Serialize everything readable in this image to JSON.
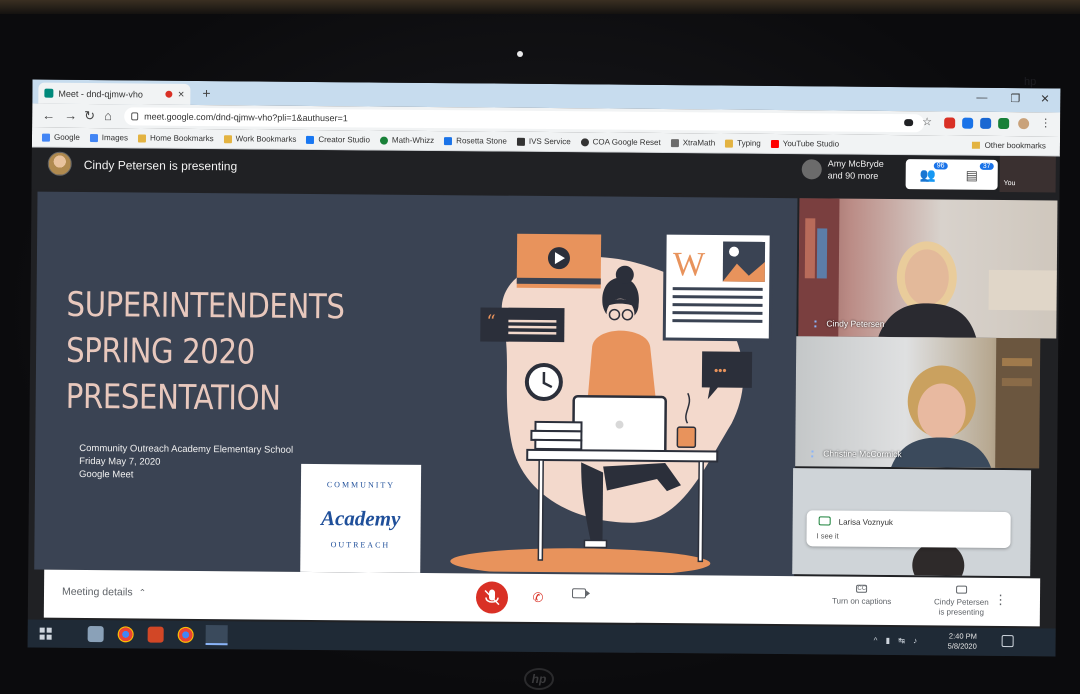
{
  "browser": {
    "tab_title": "Meet - dnd-qjmw-vho",
    "tab_close": "×",
    "new_tab": "+",
    "url": "meet.google.com/dnd-qjmw-vho?pli=1&authuser=1",
    "bookmarks": [
      {
        "label": "Google",
        "color": "#4285f4"
      },
      {
        "label": "Images",
        "color": "#4285f4"
      },
      {
        "label": "Home Bookmarks",
        "color": "#e3b341"
      },
      {
        "label": "Work Bookmarks",
        "color": "#e3b341"
      },
      {
        "label": "Creator Studio",
        "color": "#1877f2"
      },
      {
        "label": "Math-Whizz",
        "color": "#188038"
      },
      {
        "label": "Rosetta Stone",
        "color": "#1a73e8"
      },
      {
        "label": "IVS Service",
        "color": "#333333"
      },
      {
        "label": "COA Google Reset",
        "color": "#333333"
      },
      {
        "label": "XtraMath",
        "color": "#6b6b6b"
      },
      {
        "label": "Typing",
        "color": "#e3b341"
      },
      {
        "label": "YouTube Studio",
        "color": "#ff0000"
      }
    ],
    "other_bookmarks": "Other bookmarks"
  },
  "meet": {
    "presenting_label": "Cindy Petersen is presenting",
    "others_line1": "Amy McBryde",
    "others_line2": "and 90 more",
    "people_count": "96",
    "chat_count": "37",
    "you_label": "You",
    "participants": [
      {
        "name": "Cindy Petersen"
      },
      {
        "name": "Christine McCormick"
      }
    ],
    "chat": {
      "sender": "Larisa Voznyuk",
      "message": "I see it"
    },
    "meeting_details": "Meeting details",
    "captions_icon": "CC",
    "captions_label": "Turn on captions",
    "present_line1": "Cindy Petersen",
    "present_line2": "is presenting",
    "more_glyph": "⋮"
  },
  "slide": {
    "title_line1": "SUPERINTENDENTS",
    "title_line2": "SPRING 2020",
    "title_line3": "PRESENTATION",
    "sub_line1": "Community Outreach Academy Elementary School",
    "sub_line2": "Friday May 7, 2020",
    "sub_line3": "Google Meet",
    "logo_top": "COMMUNITY",
    "logo_main": "Academy",
    "logo_bottom": "OUTREACH",
    "doc_letter": "W",
    "chat_dots": "•••",
    "quote_mark": "“"
  },
  "taskbar": {
    "time": "2:40 PM",
    "date": "5/8/2020"
  },
  "hardware": {
    "brand": "hp",
    "model": "hp"
  },
  "colors": {
    "slide_bg": "#3a4353",
    "slide_title": "#e8c8bd",
    "accent_orange": "#e8935c",
    "mic_red": "#d93025"
  }
}
